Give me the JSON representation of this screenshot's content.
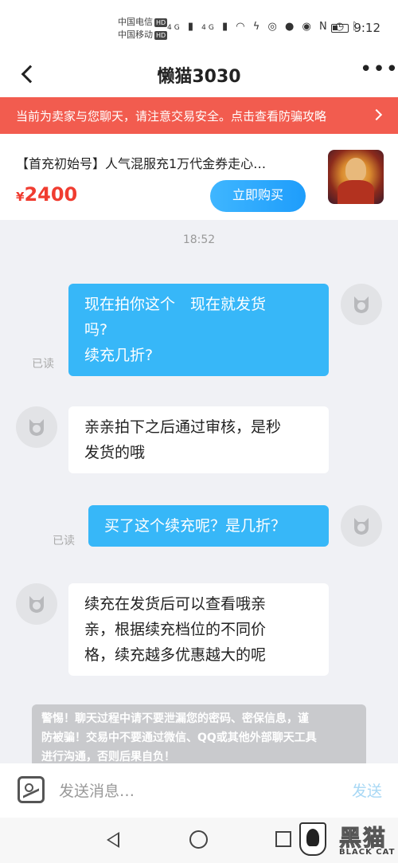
{
  "status_bar": {
    "carrier1": "中国电信",
    "carrier2": "中国移动",
    "hd": "HD",
    "net": "4G",
    "time": "9:12"
  },
  "header": {
    "title": "懒猫3030",
    "more": "•••"
  },
  "banner": {
    "text": "当前为卖家与您聊天，请注意交易安全。点击查看防骗攻略"
  },
  "product": {
    "title": "【首充初始号】人气混服充1万代金券走心…",
    "currency": "¥",
    "price": "2400",
    "buy_label": "立即购买"
  },
  "chat": {
    "timestamp": "18:52",
    "messages": [
      {
        "from": "me",
        "lines": [
          "现在拍你这个　现在就发货",
          "吗?",
          "续充几折?"
        ],
        "status": "已读"
      },
      {
        "from": "them",
        "lines": [
          "亲亲拍下之后通过审核，是秒",
          "发货的哦"
        ]
      },
      {
        "from": "me",
        "lines": [
          "买了这个续充呢？是几折？"
        ],
        "status": "已读"
      },
      {
        "from": "them",
        "lines": [
          "续充在发货后可以查看哦亲",
          "亲，根据续充档位的不同价",
          "格，续充越多优惠越大的呢"
        ]
      }
    ],
    "notice_lines": [
      "警惕！聊天过程中请不要泄漏您的密码、密保信息，谨",
      "防被骗！交易中不要通过微信、QQ或其他外部聊天工具",
      "进行沟通，否则后果自负！"
    ]
  },
  "input": {
    "placeholder": "发送消息…",
    "send_label": "发送"
  },
  "watermark": {
    "cn": "黑猫",
    "en": "BLACK CAT"
  }
}
